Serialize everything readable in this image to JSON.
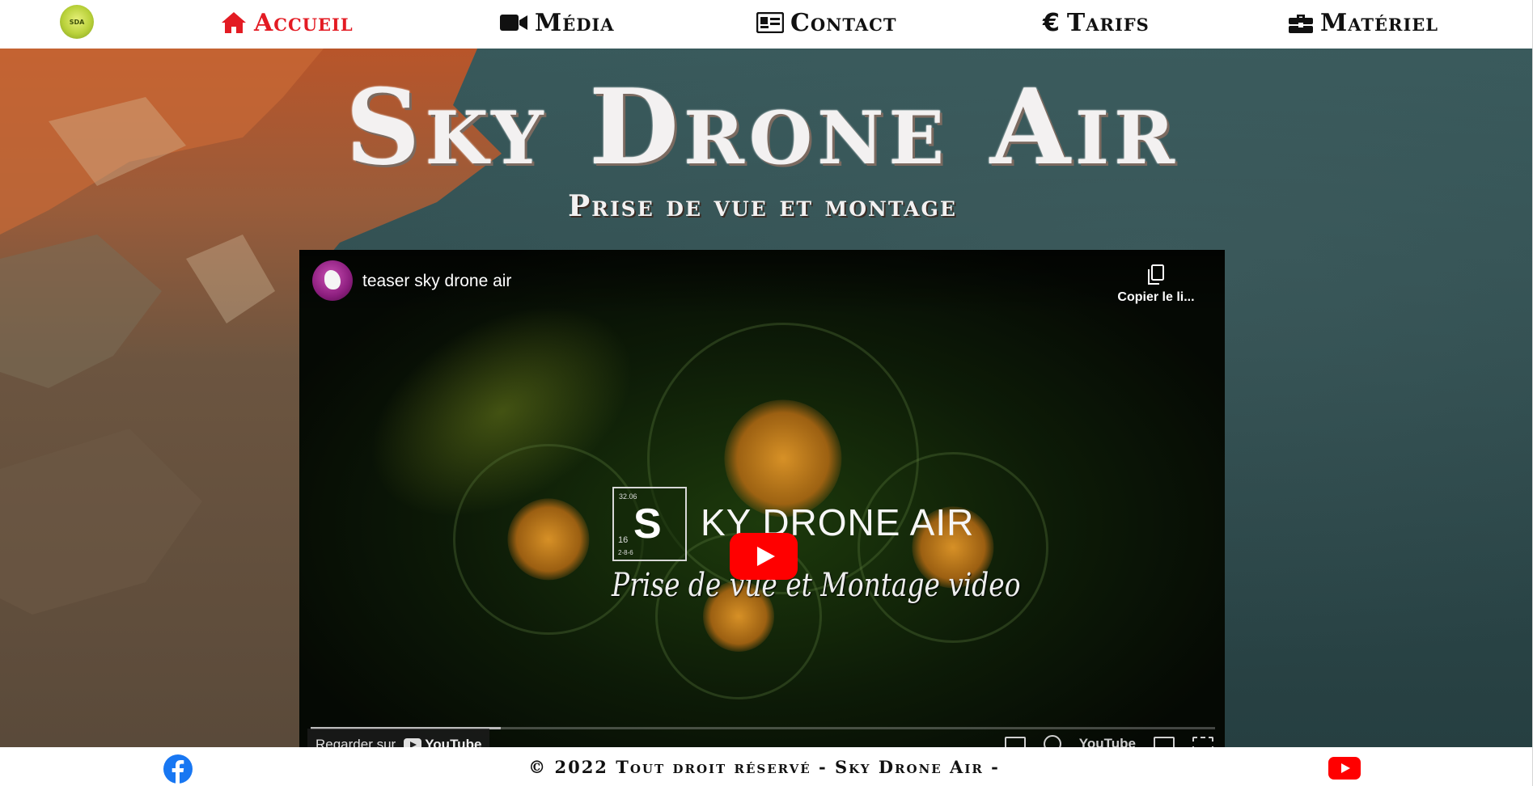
{
  "nav": {
    "logo_alt": "Sky Drone Air",
    "items": [
      {
        "label": "Accueil",
        "icon": "home-icon",
        "active": true
      },
      {
        "label": "Média",
        "icon": "video-camera-icon",
        "active": false
      },
      {
        "label": "Contact",
        "icon": "address-card-icon",
        "active": false
      },
      {
        "label": "Tarifs",
        "icon": "euro-icon",
        "active": false
      },
      {
        "label": "Matériel",
        "icon": "toolbox-icon",
        "active": false
      }
    ]
  },
  "hero": {
    "title": "Sky Drone Air",
    "subtitle": "Prise de vue et montage"
  },
  "video": {
    "title": "teaser sky drone air",
    "copy_link_label": "Copier le li...",
    "frame_brand_letter": "S",
    "frame_brand_number": "16",
    "frame_brand_tl": "32.06",
    "frame_brand_bl": "2-8-6",
    "frame_brand_text": "KY DRONE AIR",
    "frame_subtitle": "Prise de vue et Montage video",
    "watch_on_label": "Regarder sur",
    "watch_on_brand": "YouTube",
    "controls_brand": "YouTube",
    "progress": 0.21
  },
  "footer": {
    "copyright": "© 2022 Tout droit réservé - Sky Drone Air -"
  },
  "colors": {
    "accent_red": "#e31b23",
    "youtube_red": "#ff0000",
    "facebook_blue": "#1877f2"
  }
}
